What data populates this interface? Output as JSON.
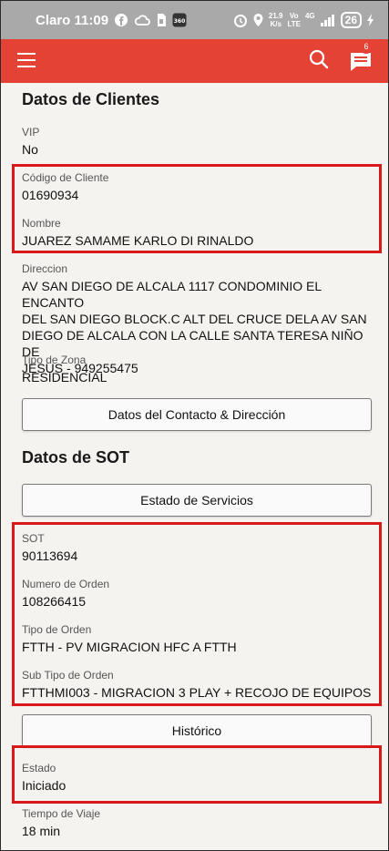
{
  "status_bar": {
    "carrier_time": "Claro 11:09",
    "net_speed_top": "21.9",
    "net_speed_bottom": "K/s",
    "network_top": "Vo",
    "network_mid": "LTE",
    "network_type": "4G",
    "battery": "26",
    "icons": [
      "facebook-icon",
      "cloud-icon",
      "sim-icon",
      "app-360-icon",
      "alarm-icon",
      "location-icon",
      "signal-icon",
      "charging-icon"
    ]
  },
  "app_bar": {
    "color": "#e34234",
    "notification_count": "6",
    "icons": [
      "menu-icon",
      "search-icon",
      "chat-icon"
    ]
  },
  "clientes": {
    "title": "Datos de Clientes",
    "vip_label": "VIP",
    "vip_value": "No",
    "codigo_label": "Código de Cliente",
    "codigo_value": "01690934",
    "nombre_label": "Nombre",
    "nombre_value": "JUAREZ SAMAME KARLO DI RINALDO",
    "direccion_label": "Direccion",
    "direccion_lines": [
      "AV SAN DIEGO DE ALCALA 1117 CONDOMINIO EL ENCANTO",
      "DEL SAN DIEGO BLOCK.C ALT DEL CRUCE DELA AV SAN",
      "DIEGO DE ALCALA CON LA CALLE SANTA TERESA NIÑO DE",
      "JESUS - 949255475"
    ],
    "tipo_zona_label": "Tipo de Zona",
    "tipo_zona_value": "RESIDENCIAL",
    "contacto_button": "Datos del Contacto & Dirección"
  },
  "sot": {
    "title": "Datos de SOT",
    "estado_servicios_button": "Estado de Servicios",
    "sot_label": "SOT",
    "sot_value": "90113694",
    "orden_label": "Numero de Orden",
    "orden_value": "108266415",
    "tipo_orden_label": "Tipo de Orden",
    "tipo_orden_value": "FTTH - PV MIGRACION HFC A FTTH",
    "subtipo_label": "Sub Tipo de Orden",
    "subtipo_value": "FTTHMI003 - MIGRACION 3 PLAY + RECOJO DE EQUIPOS",
    "historico_button": "Histórico",
    "estado_label": "Estado",
    "estado_value": "Iniciado",
    "tiempo_label": "Tiempo de Viaje",
    "tiempo_value": "18 min"
  },
  "highlight_color": "#d9181a"
}
